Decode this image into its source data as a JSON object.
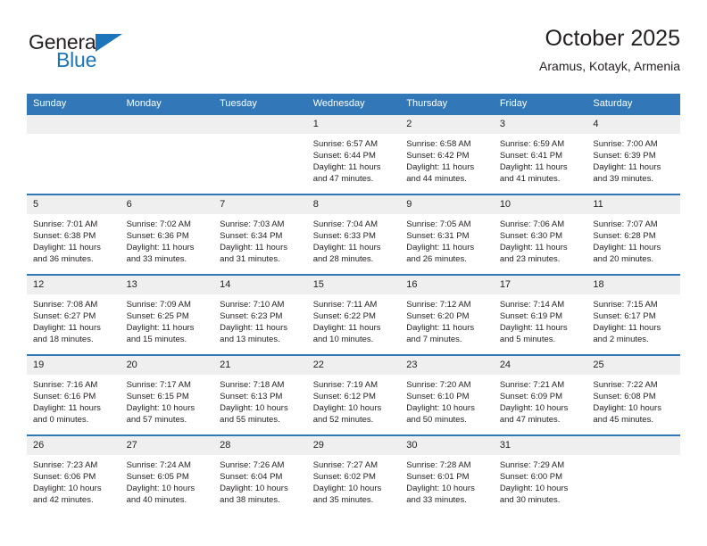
{
  "brand": {
    "name_top": "General",
    "name_bottom": "Blue",
    "accent_color": "#1b75bb"
  },
  "header": {
    "title": "October 2025",
    "subtitle": "Aramus, Kotayk, Armenia",
    "header_bg": "#3277b8",
    "daynum_bg": "#efefef"
  },
  "weekday_headers": [
    "Sunday",
    "Monday",
    "Tuesday",
    "Wednesday",
    "Thursday",
    "Friday",
    "Saturday"
  ],
  "labels": {
    "sunrise_prefix": "Sunrise: ",
    "sunset_prefix": "Sunset: ",
    "daylight_prefix": "Daylight: "
  },
  "weeks": [
    [
      {
        "day": "",
        "empty": true
      },
      {
        "day": "",
        "empty": true
      },
      {
        "day": "",
        "empty": true
      },
      {
        "day": "1",
        "sunrise": "Sunrise: 6:57 AM",
        "sunset": "Sunset: 6:44 PM",
        "daylight": "Daylight: 11 hours and 47 minutes."
      },
      {
        "day": "2",
        "sunrise": "Sunrise: 6:58 AM",
        "sunset": "Sunset: 6:42 PM",
        "daylight": "Daylight: 11 hours and 44 minutes."
      },
      {
        "day": "3",
        "sunrise": "Sunrise: 6:59 AM",
        "sunset": "Sunset: 6:41 PM",
        "daylight": "Daylight: 11 hours and 41 minutes."
      },
      {
        "day": "4",
        "sunrise": "Sunrise: 7:00 AM",
        "sunset": "Sunset: 6:39 PM",
        "daylight": "Daylight: 11 hours and 39 minutes."
      }
    ],
    [
      {
        "day": "5",
        "sunrise": "Sunrise: 7:01 AM",
        "sunset": "Sunset: 6:38 PM",
        "daylight": "Daylight: 11 hours and 36 minutes."
      },
      {
        "day": "6",
        "sunrise": "Sunrise: 7:02 AM",
        "sunset": "Sunset: 6:36 PM",
        "daylight": "Daylight: 11 hours and 33 minutes."
      },
      {
        "day": "7",
        "sunrise": "Sunrise: 7:03 AM",
        "sunset": "Sunset: 6:34 PM",
        "daylight": "Daylight: 11 hours and 31 minutes."
      },
      {
        "day": "8",
        "sunrise": "Sunrise: 7:04 AM",
        "sunset": "Sunset: 6:33 PM",
        "daylight": "Daylight: 11 hours and 28 minutes."
      },
      {
        "day": "9",
        "sunrise": "Sunrise: 7:05 AM",
        "sunset": "Sunset: 6:31 PM",
        "daylight": "Daylight: 11 hours and 26 minutes."
      },
      {
        "day": "10",
        "sunrise": "Sunrise: 7:06 AM",
        "sunset": "Sunset: 6:30 PM",
        "daylight": "Daylight: 11 hours and 23 minutes."
      },
      {
        "day": "11",
        "sunrise": "Sunrise: 7:07 AM",
        "sunset": "Sunset: 6:28 PM",
        "daylight": "Daylight: 11 hours and 20 minutes."
      }
    ],
    [
      {
        "day": "12",
        "sunrise": "Sunrise: 7:08 AM",
        "sunset": "Sunset: 6:27 PM",
        "daylight": "Daylight: 11 hours and 18 minutes."
      },
      {
        "day": "13",
        "sunrise": "Sunrise: 7:09 AM",
        "sunset": "Sunset: 6:25 PM",
        "daylight": "Daylight: 11 hours and 15 minutes."
      },
      {
        "day": "14",
        "sunrise": "Sunrise: 7:10 AM",
        "sunset": "Sunset: 6:23 PM",
        "daylight": "Daylight: 11 hours and 13 minutes."
      },
      {
        "day": "15",
        "sunrise": "Sunrise: 7:11 AM",
        "sunset": "Sunset: 6:22 PM",
        "daylight": "Daylight: 11 hours and 10 minutes."
      },
      {
        "day": "16",
        "sunrise": "Sunrise: 7:12 AM",
        "sunset": "Sunset: 6:20 PM",
        "daylight": "Daylight: 11 hours and 7 minutes."
      },
      {
        "day": "17",
        "sunrise": "Sunrise: 7:14 AM",
        "sunset": "Sunset: 6:19 PM",
        "daylight": "Daylight: 11 hours and 5 minutes."
      },
      {
        "day": "18",
        "sunrise": "Sunrise: 7:15 AM",
        "sunset": "Sunset: 6:17 PM",
        "daylight": "Daylight: 11 hours and 2 minutes."
      }
    ],
    [
      {
        "day": "19",
        "sunrise": "Sunrise: 7:16 AM",
        "sunset": "Sunset: 6:16 PM",
        "daylight": "Daylight: 11 hours and 0 minutes."
      },
      {
        "day": "20",
        "sunrise": "Sunrise: 7:17 AM",
        "sunset": "Sunset: 6:15 PM",
        "daylight": "Daylight: 10 hours and 57 minutes."
      },
      {
        "day": "21",
        "sunrise": "Sunrise: 7:18 AM",
        "sunset": "Sunset: 6:13 PM",
        "daylight": "Daylight: 10 hours and 55 minutes."
      },
      {
        "day": "22",
        "sunrise": "Sunrise: 7:19 AM",
        "sunset": "Sunset: 6:12 PM",
        "daylight": "Daylight: 10 hours and 52 minutes."
      },
      {
        "day": "23",
        "sunrise": "Sunrise: 7:20 AM",
        "sunset": "Sunset: 6:10 PM",
        "daylight": "Daylight: 10 hours and 50 minutes."
      },
      {
        "day": "24",
        "sunrise": "Sunrise: 7:21 AM",
        "sunset": "Sunset: 6:09 PM",
        "daylight": "Daylight: 10 hours and 47 minutes."
      },
      {
        "day": "25",
        "sunrise": "Sunrise: 7:22 AM",
        "sunset": "Sunset: 6:08 PM",
        "daylight": "Daylight: 10 hours and 45 minutes."
      }
    ],
    [
      {
        "day": "26",
        "sunrise": "Sunrise: 7:23 AM",
        "sunset": "Sunset: 6:06 PM",
        "daylight": "Daylight: 10 hours and 42 minutes."
      },
      {
        "day": "27",
        "sunrise": "Sunrise: 7:24 AM",
        "sunset": "Sunset: 6:05 PM",
        "daylight": "Daylight: 10 hours and 40 minutes."
      },
      {
        "day": "28",
        "sunrise": "Sunrise: 7:26 AM",
        "sunset": "Sunset: 6:04 PM",
        "daylight": "Daylight: 10 hours and 38 minutes."
      },
      {
        "day": "29",
        "sunrise": "Sunrise: 7:27 AM",
        "sunset": "Sunset: 6:02 PM",
        "daylight": "Daylight: 10 hours and 35 minutes."
      },
      {
        "day": "30",
        "sunrise": "Sunrise: 7:28 AM",
        "sunset": "Sunset: 6:01 PM",
        "daylight": "Daylight: 10 hours and 33 minutes."
      },
      {
        "day": "31",
        "sunrise": "Sunrise: 7:29 AM",
        "sunset": "Sunset: 6:00 PM",
        "daylight": "Daylight: 10 hours and 30 minutes."
      },
      {
        "day": "",
        "empty": true
      }
    ]
  ]
}
